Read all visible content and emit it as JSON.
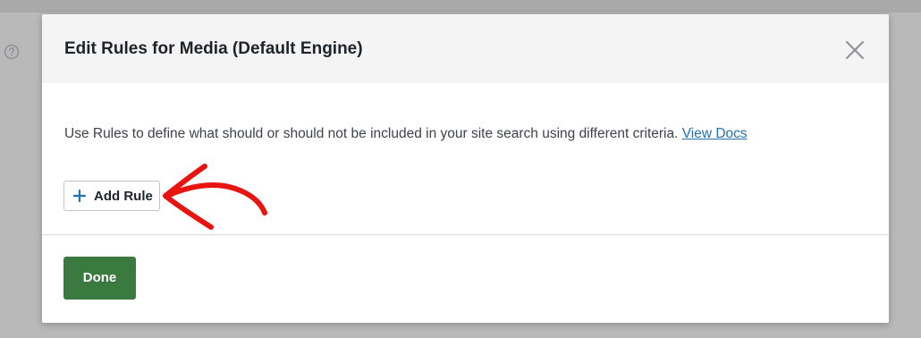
{
  "modal": {
    "title": "Edit Rules for Media (Default Engine)",
    "description": "Use Rules to define what should or should not be included in your site search using different criteria.",
    "docs_link": "View Docs",
    "add_rule_label": "Add Rule",
    "done_label": "Done"
  },
  "icons": {
    "help": "question-circle-icon",
    "close": "close-icon",
    "add": "plus-icon",
    "annotation": "red-arrow-annotation"
  },
  "colors": {
    "accent_blue": "#2271b1",
    "done_green": "#3a7a3f",
    "annotation_red": "#e8140f"
  }
}
